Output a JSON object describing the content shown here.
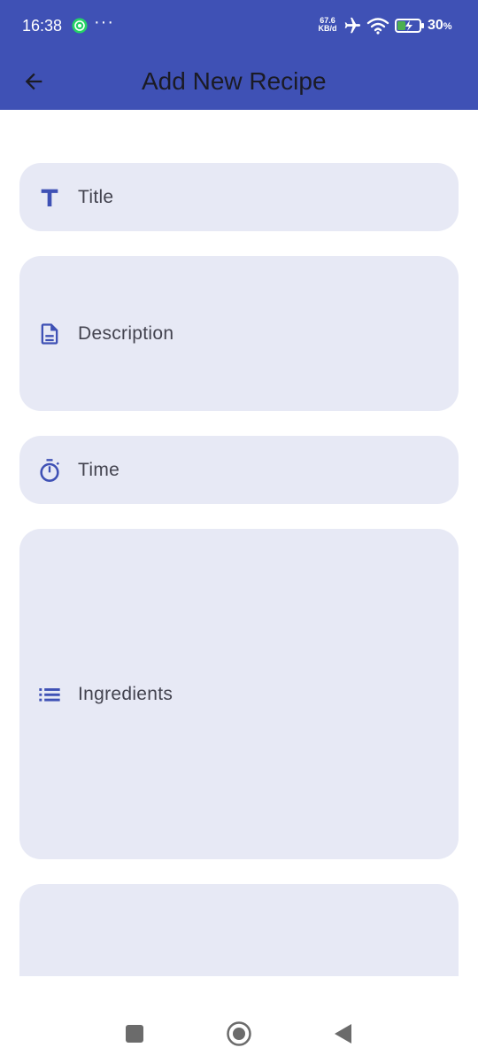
{
  "status_bar": {
    "time": "16:38",
    "dots": "···",
    "net_rate_value": "67.6",
    "net_rate_unit": "KB/d",
    "battery_value": "30",
    "battery_unit": "%"
  },
  "app_bar": {
    "title": "Add New Recipe",
    "back_icon": "arrow-left-icon"
  },
  "form": {
    "fields": [
      {
        "label": "Title",
        "icon": "title-text-icon"
      },
      {
        "label": "Description",
        "icon": "document-icon"
      },
      {
        "label": "Time",
        "icon": "timer-icon"
      },
      {
        "label": "Ingredients",
        "icon": "list-icon"
      },
      {
        "label": "",
        "icon": ""
      }
    ]
  },
  "colors": {
    "app_bar": "#3f51b5",
    "field_fill": "#e7e9f5",
    "icon": "#3f51b5",
    "label": "#43434f"
  },
  "nav_bar": {
    "icons": [
      "recents-square-icon",
      "home-circle-icon",
      "back-triangle-icon"
    ]
  }
}
